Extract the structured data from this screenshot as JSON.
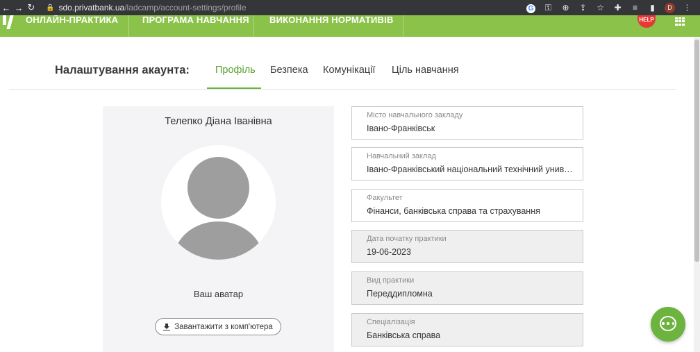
{
  "browser": {
    "url_host": "sdo.privatbank.ua",
    "url_path": "/ladcamp/account-settings/profile",
    "profile_initial": "D"
  },
  "header": {
    "nav": [
      "ОНЛАЙН-ПРАКТИКА",
      "ПРОГРАМА НАВЧАННЯ",
      "ВИКОНАННЯ НОРМАТИВІВ"
    ],
    "help_label": "HELP"
  },
  "settings": {
    "title": "Налаштування акаунта:",
    "tabs": [
      "Профіль",
      "Безпека",
      "Комунікації",
      "Ціль навчання"
    ],
    "active_tab": "Профіль"
  },
  "profile": {
    "name": "Телепко Діана Іванівна",
    "avatar_caption": "Ваш аватар",
    "upload_label": "Завантажити з комп'ютера"
  },
  "fields": [
    {
      "label": "Місто навчального закладу",
      "value": "Івано-Франківськ"
    },
    {
      "label": "Навчальний заклад",
      "value": "Івано-Франківський національний технічний униве..."
    },
    {
      "label": "Факультет",
      "value": "Фінанси, банківська справа та страхування"
    },
    {
      "label": "Дата початку практики",
      "value": "19-06-2023"
    },
    {
      "label": "Вид практики",
      "value": "Переддипломна"
    },
    {
      "label": "Спеціалізація",
      "value": "Банківська справа"
    }
  ],
  "colors": {
    "brand_green": "#8bc34a",
    "accent_green": "#5aa02c",
    "help_red": "#e53935"
  }
}
